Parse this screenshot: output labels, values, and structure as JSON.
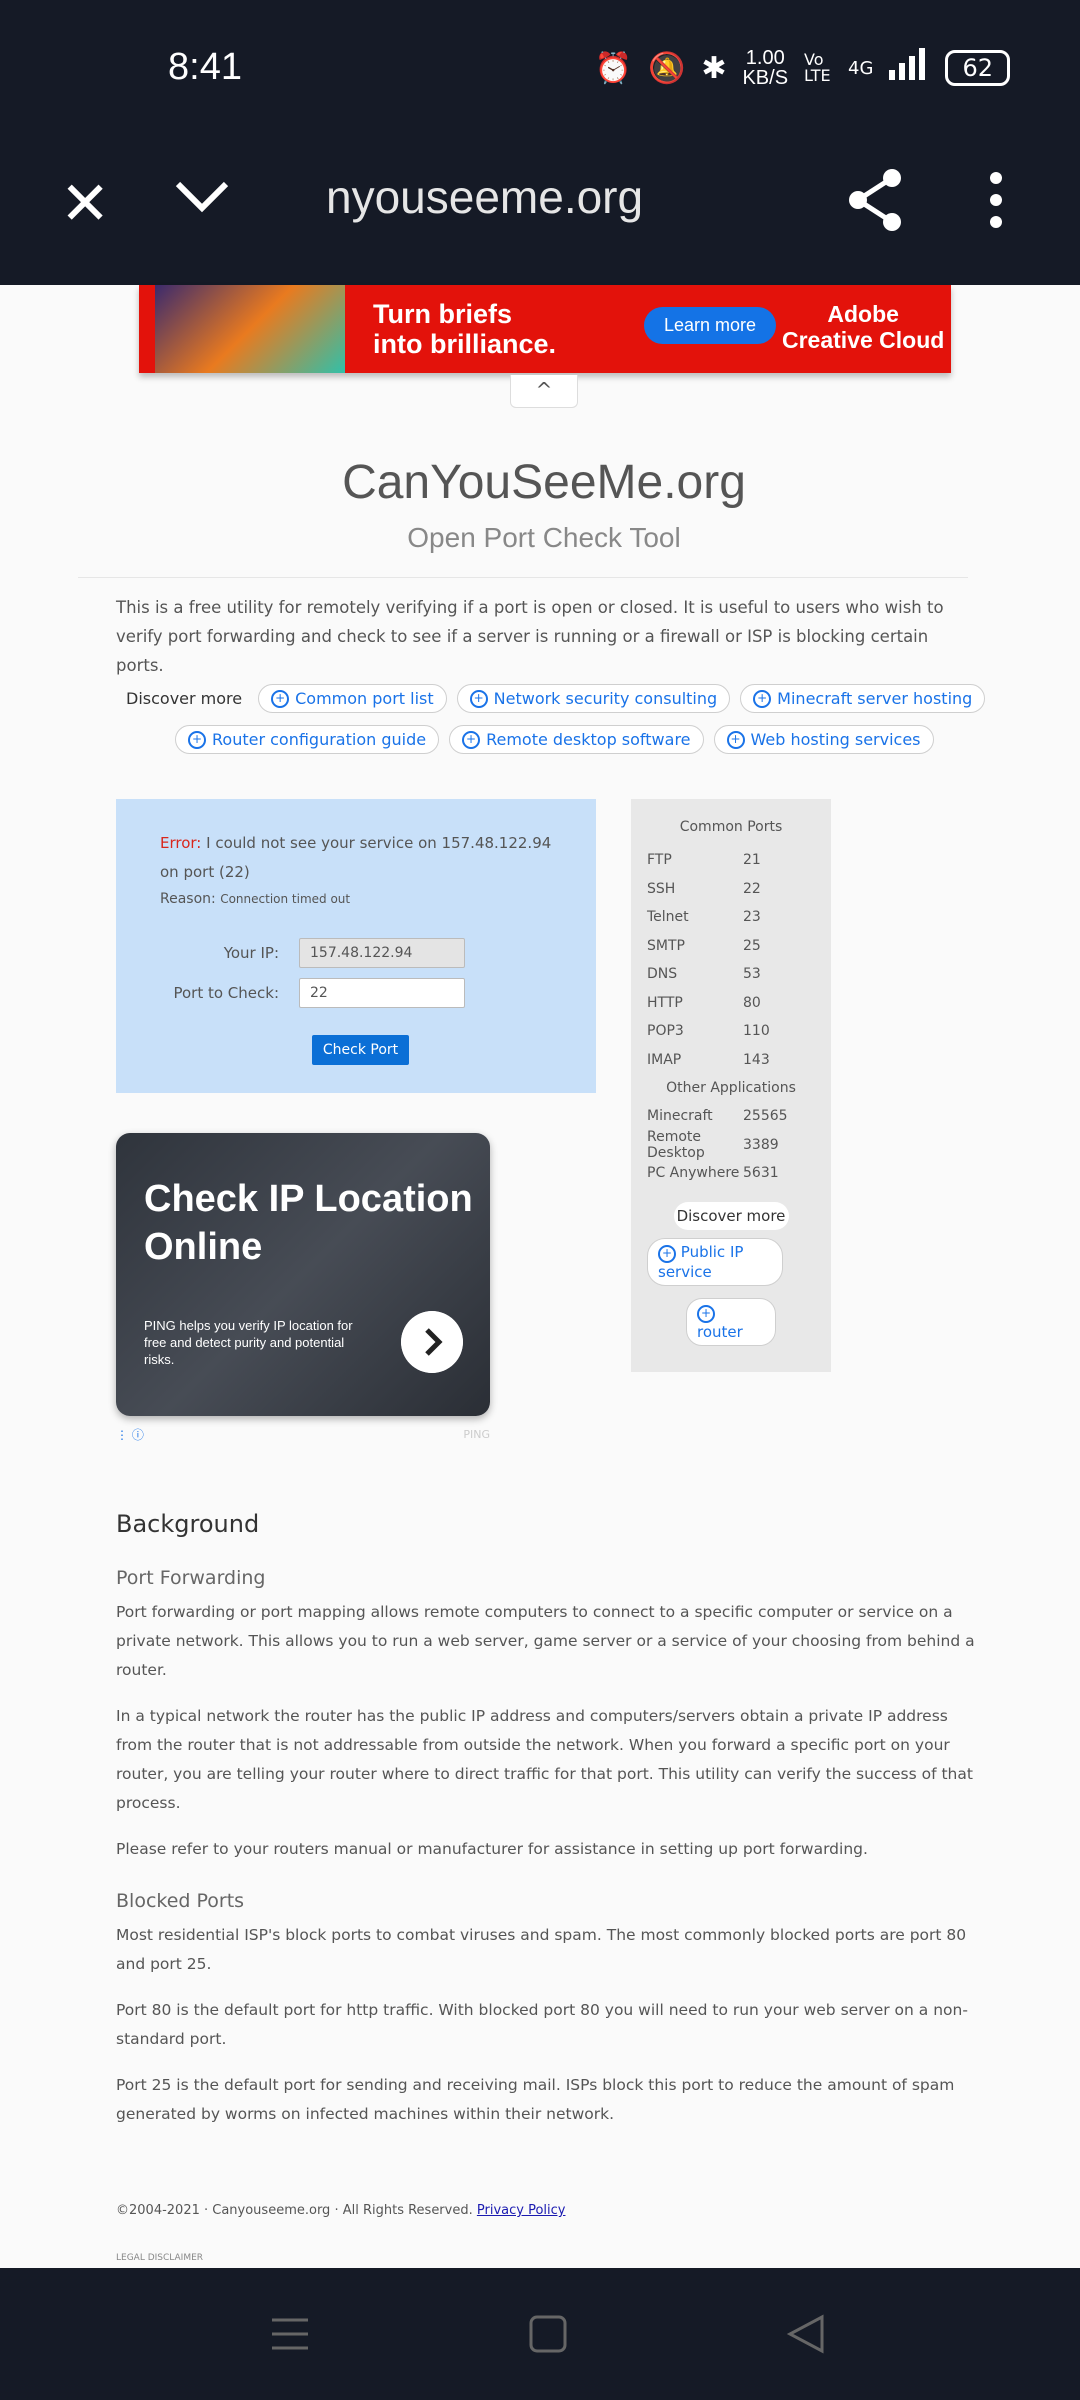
{
  "status_bar": {
    "time": "8:41",
    "speed_value": "1.00",
    "speed_unit": "KB/S",
    "volte": "Vo LTE",
    "network": "4G",
    "battery": "62"
  },
  "browser": {
    "url": "nyouseeme.org",
    "icons": [
      "close-icon",
      "chevron-down-icon",
      "share-icon",
      "more-vert-icon"
    ]
  },
  "ad_banner": {
    "headline_line1": "Turn briefs",
    "headline_line2": "into brilliance.",
    "cta": "Learn more",
    "brand_line1": "Adobe",
    "brand_line2": "Creative Cloud",
    "collapse_glyph": "^"
  },
  "header": {
    "title": "CanYouSeeMe.org",
    "subtitle": "Open Port Check Tool"
  },
  "intro": "This is a free utility for remotely verifying if a port is open or closed. It is useful to users who wish to verify port forwarding and check to see if a server is running or a firewall or ISP is blocking certain ports.",
  "discover": {
    "label": "Discover more",
    "row1": [
      "Common port list",
      "Network security consulting",
      "Minecraft server hosting"
    ],
    "row2": [
      "Router configuration guide",
      "Remote desktop software",
      "Web hosting services"
    ]
  },
  "check_form": {
    "error_label": "Error:",
    "error_text": "I could not see your service on 157.48.122.94 on port (22)",
    "reason_label": "Reason:",
    "reason_text": "Connection timed out",
    "ip_label": "Your IP:",
    "ip_value": "157.48.122.94",
    "port_label": "Port to Check:",
    "port_value": "22",
    "button": "Check Port"
  },
  "ip_ad": {
    "title": "Check IP Location Online",
    "body": "PING helps you verify IP location for free and detect purity and potential risks.",
    "source": "PING"
  },
  "common_ports": {
    "title": "Common Ports",
    "ports": [
      {
        "name": "FTP",
        "port": "21"
      },
      {
        "name": "SSH",
        "port": "22"
      },
      {
        "name": "Telnet",
        "port": "23"
      },
      {
        "name": "SMTP",
        "port": "25"
      },
      {
        "name": "DNS",
        "port": "53"
      },
      {
        "name": "HTTP",
        "port": "80"
      },
      {
        "name": "POP3",
        "port": "110"
      },
      {
        "name": "IMAP",
        "port": "143"
      }
    ],
    "other_title": "Other Applications",
    "other": [
      {
        "name": "Minecraft",
        "port": "25565"
      },
      {
        "name": "Remote Desktop",
        "port": "3389"
      },
      {
        "name": "PC Anywhere",
        "port": "5631"
      }
    ],
    "discover_label": "Discover more",
    "chip1": "Public IP service",
    "chip2": "router"
  },
  "background": {
    "heading": "Background",
    "pf_heading": "Port Forwarding",
    "pf_p1": "Port forwarding or port mapping allows remote computers to connect to a specific computer or service on a private network. This allows you to run a web server, game server or a service of your choosing from behind a router.",
    "pf_p2": "In a typical network the router has the public IP address and computers/servers obtain a private IP address from the router that is not addressable from outside the network. When you forward a specific port on your router, you are telling your router where to direct traffic for that port. This utility can verify the success of that process.",
    "pf_p3": "Please refer to your routers manual or manufacturer for assistance in setting up port forwarding.",
    "bp_heading": "Blocked Ports",
    "bp_p1": "Most residential ISP's block ports to combat viruses and spam. The most commonly blocked ports are port 80 and port 25.",
    "bp_p2": "Port 80 is the default port for http traffic. With blocked port 80 you will need to run your web server on a non-standard port.",
    "bp_p3": "Port 25 is the default port for sending and receiving mail. ISPs block this port to reduce the amount of spam generated by worms on infected machines within their network."
  },
  "footer": {
    "copyright": "©2004-2021 · Canyouseeme.org · All Rights Reserved.",
    "privacy": "Privacy Policy",
    "legal": "LEGAL DISCLAIMER"
  },
  "nav_bar": {
    "icons": [
      "menu-icon",
      "home-icon",
      "back-icon"
    ]
  }
}
